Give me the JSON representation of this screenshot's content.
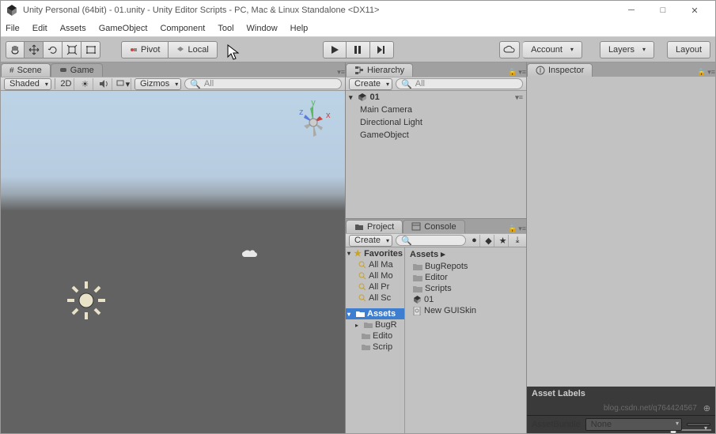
{
  "titlebar": {
    "title": "Unity Personal (64bit) - 01.unity - Unity Editor Scripts - PC, Mac & Linux Standalone <DX11>"
  },
  "menubar": [
    "File",
    "Edit",
    "Assets",
    "GameObject",
    "Component",
    "Tool",
    "Window",
    "Help"
  ],
  "toolbar": {
    "pivot": "Pivot",
    "local": "Local",
    "account": "Account",
    "layers": "Layers",
    "layout": "Layout"
  },
  "scene": {
    "tab_scene": "Scene",
    "tab_game": "Game",
    "shaded": "Shaded",
    "mode2d": "2D",
    "gizmos": "Gizmos",
    "search": "All"
  },
  "hierarchy": {
    "title": "Hierarchy",
    "create": "Create",
    "search": "All",
    "root": "01",
    "items": [
      "Main Camera",
      "Directional Light",
      "GameObject"
    ]
  },
  "project": {
    "title": "Project",
    "console": "Console",
    "create": "Create",
    "favorites": "Favorites",
    "fav_items": [
      "All Ma",
      "All Mo",
      "All Pr",
      "All Sc"
    ],
    "assets_label": "Assets",
    "left_assets": [
      "BugR",
      "Edito",
      "Scrip"
    ],
    "breadcrumb": "Assets ▸",
    "right_items": [
      {
        "icon": "folder",
        "name": "BugRepots"
      },
      {
        "icon": "folder",
        "name": "Editor"
      },
      {
        "icon": "folder",
        "name": "Scripts"
      },
      {
        "icon": "unity",
        "name": "01"
      },
      {
        "icon": "file",
        "name": "New GUISkin"
      }
    ]
  },
  "inspector": {
    "title": "Inspector",
    "asset_labels": "Asset Labels",
    "assetbundle": "AssetBundle",
    "none": "None"
  },
  "watermark": "blog.csdn.net/q764424567"
}
